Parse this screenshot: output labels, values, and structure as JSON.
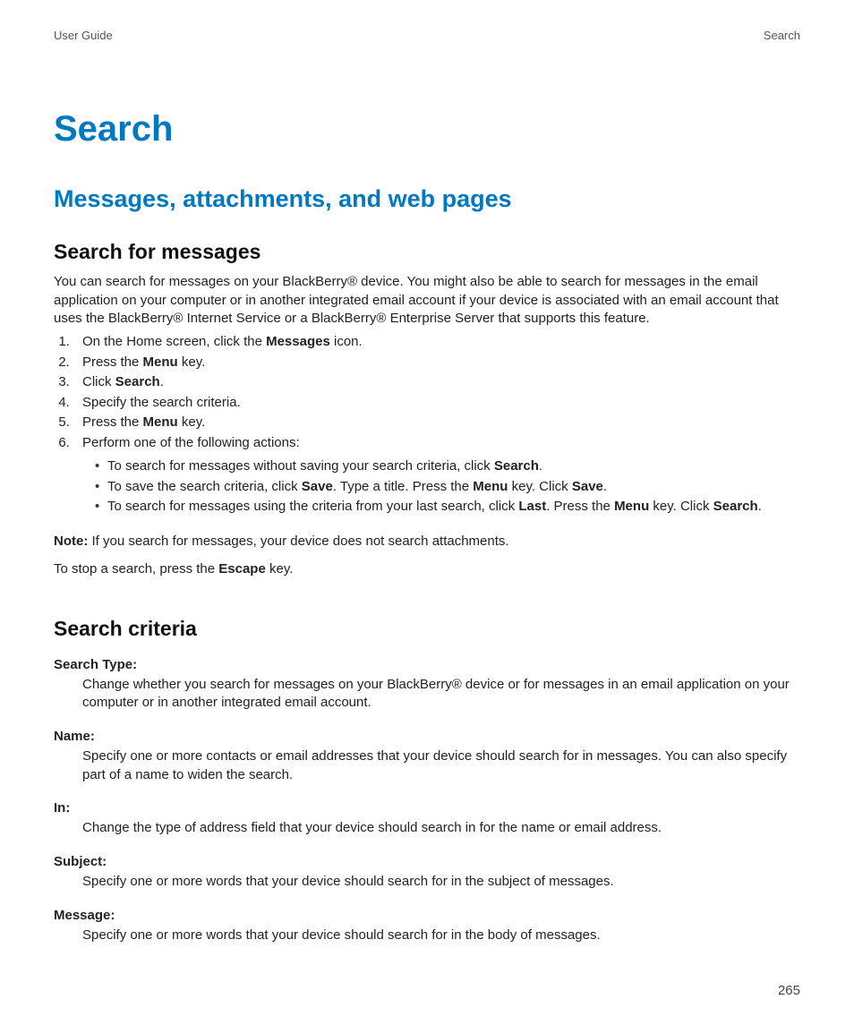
{
  "header": {
    "left": "User Guide",
    "right": "Search"
  },
  "title": "Search",
  "section": "Messages, attachments, and web pages",
  "s1": {
    "heading": "Search for messages",
    "intro": "You can search for messages on your BlackBerry® device. You might also be able to search for messages in the email application on your computer or in another integrated email account if your device is associated with an email account that uses the BlackBerry® Internet Service or a BlackBerry® Enterprise Server that supports this feature.",
    "step1_a": "On the Home screen, click the ",
    "step1_b": "Messages",
    "step1_c": " icon.",
    "step2_a": "Press the ",
    "step2_b": "Menu",
    "step2_c": " key.",
    "step3_a": "Click ",
    "step3_b": "Search",
    "step3_c": ".",
    "step4": "Specify the search criteria.",
    "step5_a": "Press the ",
    "step5_b": "Menu",
    "step5_c": " key.",
    "step6": "Perform one of the following actions:",
    "sub1_a": "To search for messages without saving your search criteria, click ",
    "sub1_b": "Search",
    "sub1_c": ".",
    "sub2_a": "To save the search criteria, click ",
    "sub2_b": "Save",
    "sub2_c": ". Type a title. Press the ",
    "sub2_d": "Menu",
    "sub2_e": " key. Click ",
    "sub2_f": "Save",
    "sub2_g": ".",
    "sub3_a": "To search for messages using the criteria from your last search, click ",
    "sub3_b": "Last",
    "sub3_c": ". Press the ",
    "sub3_d": "Menu",
    "sub3_e": " key. Click ",
    "sub3_f": "Search",
    "sub3_g": ".",
    "note_label": "Note:",
    "note_text": "  If you search for messages, your device does not search attachments.",
    "stop_a": "To stop a search, press the ",
    "stop_b": "Escape",
    "stop_c": " key."
  },
  "s2": {
    "heading": "Search criteria",
    "items": [
      {
        "label": "Search Type:",
        "desc": "Change whether you search for messages on your BlackBerry® device or for messages in an email application on your computer or in another integrated email account."
      },
      {
        "label": "Name:",
        "desc": "Specify one or more contacts or email addresses that your device should search for in messages. You can also specify part of a name to widen the search."
      },
      {
        "label": "In:",
        "desc": "Change the type of address field that your device should search in for the name or email address."
      },
      {
        "label": "Subject:",
        "desc": "Specify one or more words that your device should search for in the subject of messages."
      },
      {
        "label": "Message:",
        "desc": "Specify one or more words that your device should search for in the body of messages."
      }
    ]
  },
  "page_number": "265"
}
